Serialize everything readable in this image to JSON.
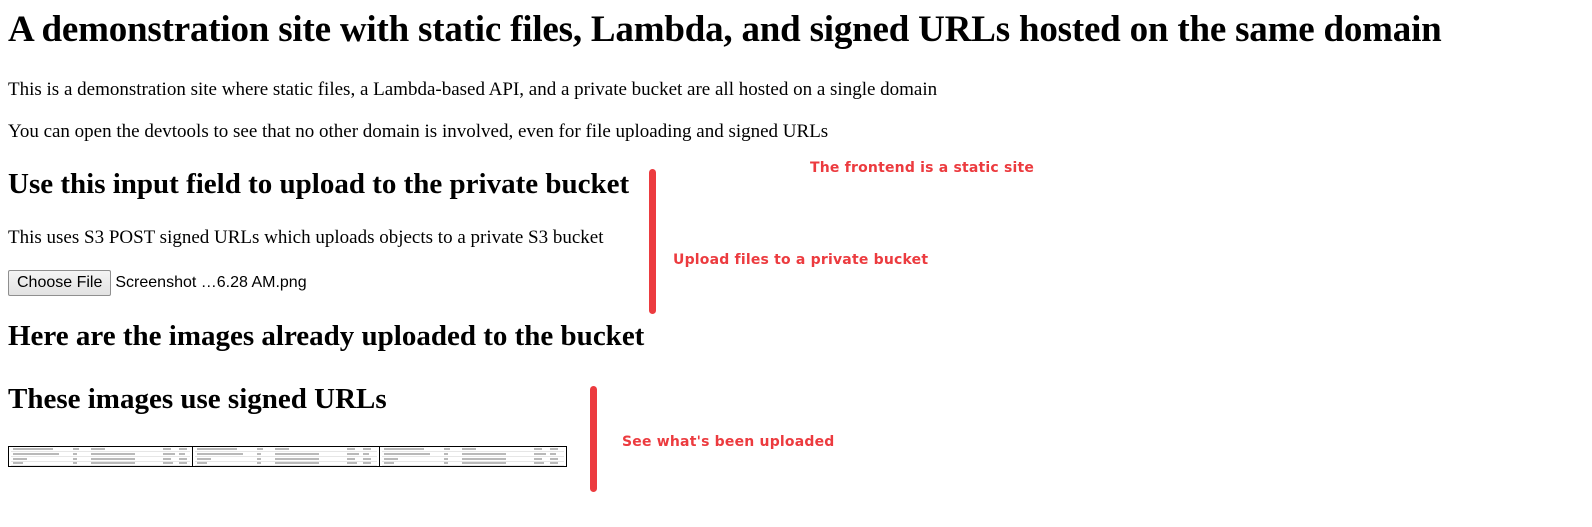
{
  "page": {
    "title": "A demonstration site with static files, Lambda, and signed URLs hosted on the same domain",
    "intro_1": "This is a demonstration site where static files, a Lambda-based API, and a private bucket are all hosted on a single domain",
    "intro_2": "You can open the devtools to see that no other domain is involved, even for file uploading and signed URLs"
  },
  "upload": {
    "heading": "Use this input field to upload to the private bucket",
    "description": "This uses S3 POST signed URLs which uploads objects to a private S3 bucket",
    "button_label": "Choose File",
    "selected_file": "Screenshot …6.28 AM.png"
  },
  "gallery": {
    "heading": "Here are the images already uploaded to the bucket",
    "subheading": "These images use signed URLs",
    "image_count": 3
  },
  "annotations": {
    "frontend": "The frontend is a static site",
    "upload": "Upload files to a private bucket",
    "uploaded": "See what's been uploaded"
  },
  "colors": {
    "annotation": "#ec3b3f"
  }
}
